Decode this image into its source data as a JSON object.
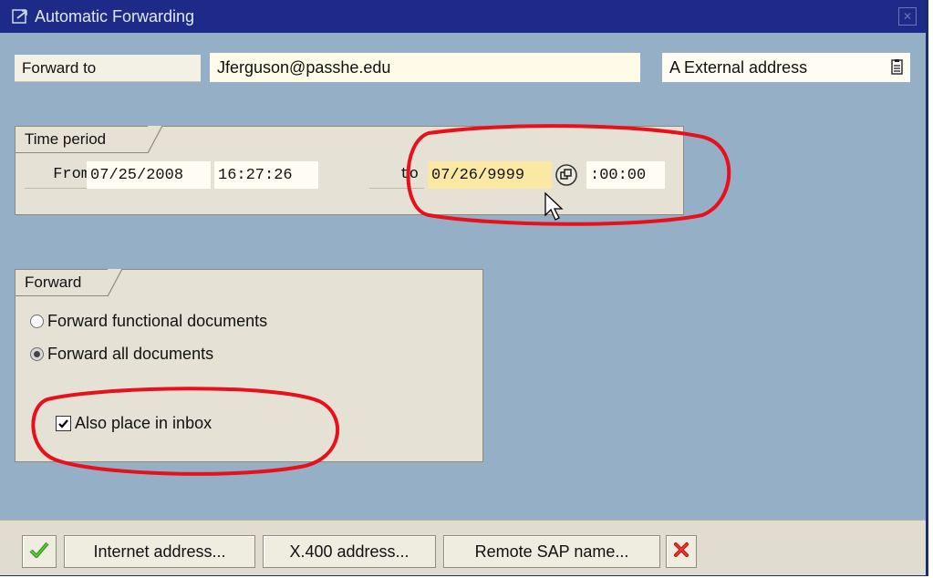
{
  "window": {
    "title": "Automatic Forwarding"
  },
  "forward_to": {
    "label": "Forward to",
    "value": "Jferguson@passhe.edu",
    "address_type": "A External address"
  },
  "time_period": {
    "group_label": "Time period",
    "from_label": "From",
    "from_date": "07/25/2008",
    "from_time": "16:27:26",
    "to_label": "to",
    "to_date": "07/26/9999",
    "to_time": ":00:00"
  },
  "forward_group": {
    "group_label": "Forward",
    "options": [
      {
        "label": "Forward functional documents",
        "selected": false
      },
      {
        "label": "Forward all documents",
        "selected": true
      }
    ],
    "inbox_label": "Also place in inbox",
    "inbox_checked": true
  },
  "toolbar": {
    "internet_label": "Internet address...",
    "x400_label": "X.400 address...",
    "remote_sap_label": "Remote SAP name..."
  },
  "icons": {
    "title": "window-edit-icon",
    "address_type": "dropdown-list-icon",
    "date_help": "possible-entries-icon",
    "confirm": "green-check-icon",
    "cancel": "red-x-icon"
  },
  "colors": {
    "titlebar": "#1e2a87",
    "background": "#95b0c6",
    "highlight_field": "#fbe9a3",
    "annotation": "#e8101a"
  }
}
